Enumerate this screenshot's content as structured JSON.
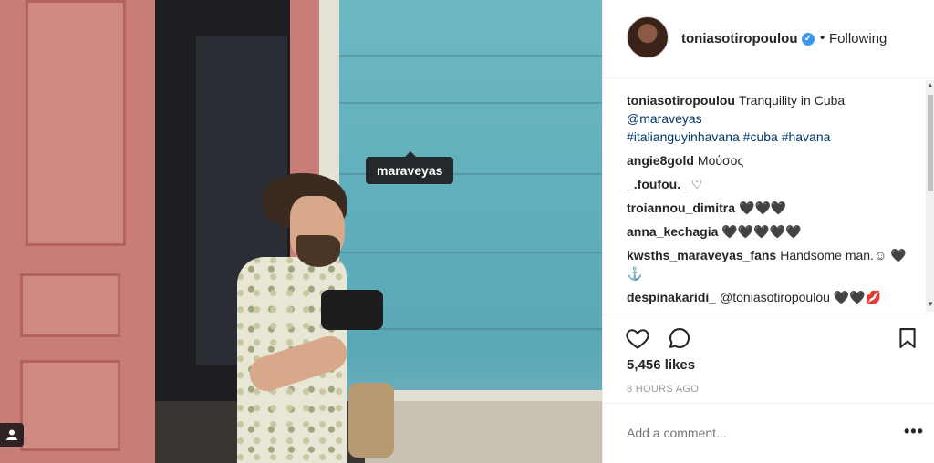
{
  "photo": {
    "tag_label": "maraveyas"
  },
  "header": {
    "username": "toniasotiropoulou",
    "separator": "•",
    "follow_status": "Following"
  },
  "caption": {
    "username": "toniasotiropoulou",
    "text": "Tranquility in Cuba",
    "mention": "@maraveyas",
    "hashtags": "#italianguyinhavana #cuba #havana"
  },
  "comments": [
    {
      "username": "angie8gold",
      "text": "Μούσος"
    },
    {
      "username": "_.foufou._",
      "text": "♡"
    },
    {
      "username": "troiannou_dimitra",
      "text": "🖤🖤🖤"
    },
    {
      "username": "anna_kechagia",
      "text": "🖤🖤🖤🖤🖤"
    },
    {
      "username": "kwsths_maraveyas_fans",
      "text": "Handsome man.☺ 🖤⚓"
    },
    {
      "username": "despinakaridi_",
      "text": "@toniasotiropoulou 🖤🖤💋"
    }
  ],
  "stats": {
    "likes": "5,456 likes",
    "time_ago": "8 HOURS AGO"
  },
  "add_comment": {
    "placeholder": "Add a comment..."
  },
  "icons": {
    "verified": "verified-badge-icon",
    "like": "heart-icon",
    "comment": "comment-icon",
    "save": "bookmark-icon",
    "more": "more-options-icon",
    "tag": "user-tag-icon"
  },
  "colors": {
    "verified": "#3897f0",
    "link": "#003569",
    "muted": "#999999"
  }
}
